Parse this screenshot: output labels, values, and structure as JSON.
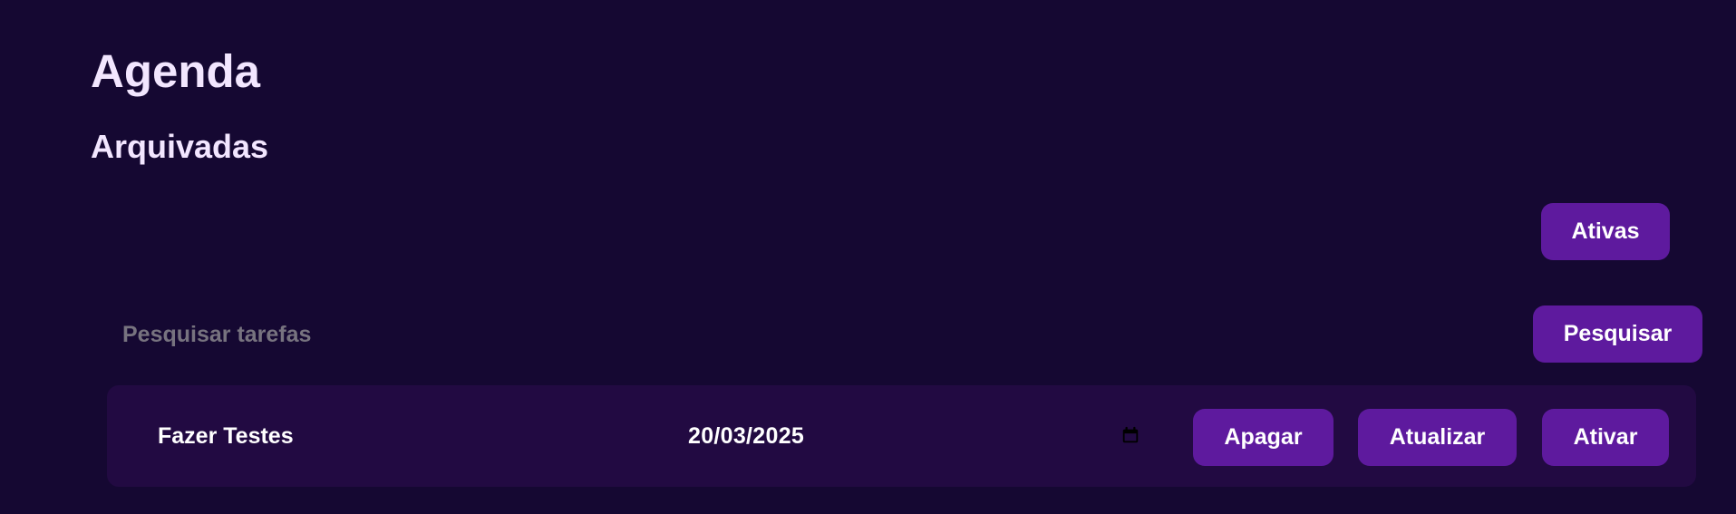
{
  "header": {
    "title": "Agenda",
    "subtitle": "Arquivadas"
  },
  "toolbar": {
    "toggle_label": "Ativas"
  },
  "search": {
    "placeholder": "Pesquisar tarefas",
    "value": "",
    "button_label": "Pesquisar"
  },
  "tasks": [
    {
      "title": "Fazer Testes",
      "date": "20/03/2025",
      "date_icon": "calendar-icon",
      "actions": {
        "delete_label": "Apagar",
        "update_label": "Atualizar",
        "activate_label": "Ativar"
      }
    }
  ],
  "colors": {
    "background": "#150832",
    "row_background": "#220a42",
    "accent": "#5e1a9e",
    "text": "#f2e6ff",
    "placeholder": "#77737f"
  }
}
